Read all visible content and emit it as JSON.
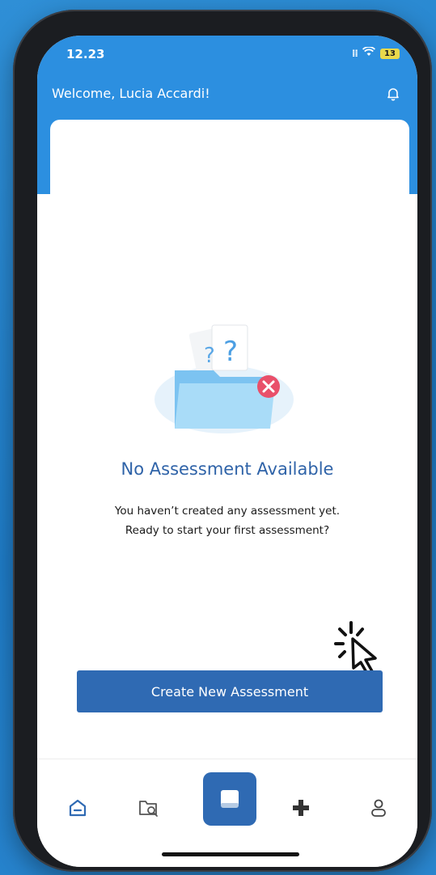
{
  "status_bar": {
    "time": "12.23",
    "battery": "13"
  },
  "header": {
    "welcome": "Welcome, Lucia Accardi!"
  },
  "empty_state": {
    "title": "No Assessment Available",
    "line1": "You haven’t created any assessment yet.",
    "line2": "Ready to start your first assessment?"
  },
  "actions": {
    "create_label": "Create New Assessment"
  },
  "nav": {
    "items": [
      {
        "icon": "home-icon"
      },
      {
        "icon": "folder-search-icon"
      },
      {
        "icon": "assessment-icon"
      },
      {
        "icon": "medical-cross-icon"
      },
      {
        "icon": "profile-icon"
      }
    ]
  },
  "colors": {
    "header": "#2c8fe0",
    "accent": "#2f6ab3",
    "title": "#2f63a8"
  }
}
